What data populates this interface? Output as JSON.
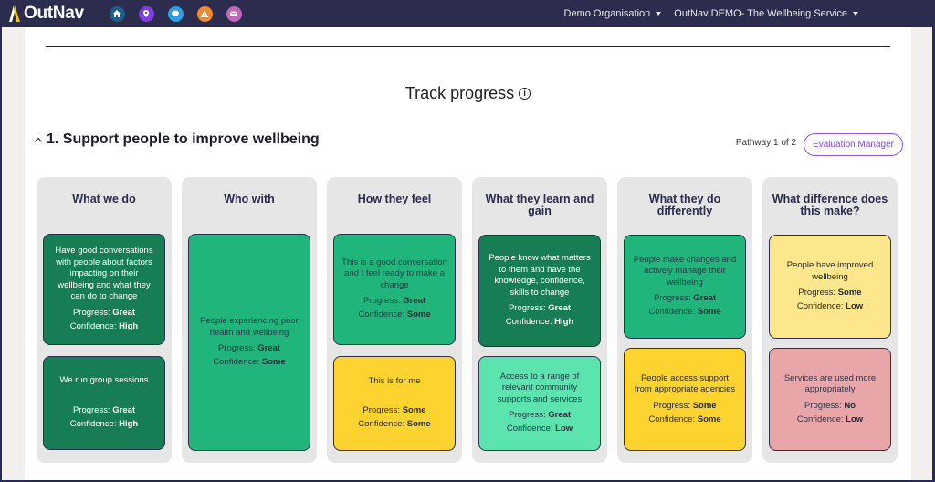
{
  "navbar": {
    "brand": "OutNav",
    "icons": [
      {
        "name": "home-icon",
        "color": "#1f5f87"
      },
      {
        "name": "map-pin-icon",
        "color": "#7d3fe0"
      },
      {
        "name": "chat-bubble-icon",
        "color": "#2d9ee0"
      },
      {
        "name": "warning-icon",
        "color": "#f2892b"
      },
      {
        "name": "envelope-icon",
        "color": "#c068b7"
      }
    ],
    "org_dropdown": "Demo Organisation",
    "service_dropdown": "OutNav DEMO- The Wellbeing Service"
  },
  "page": {
    "title": "Track progress",
    "section_title": "1. Support people to improve wellbeing",
    "pathway_info": "Pathway 1 of 2",
    "evaluation_button": "Evaluation Manager"
  },
  "labels": {
    "progress": "Progress: ",
    "confidence": "Confidence: "
  },
  "columns": [
    {
      "title": "What we do",
      "cards": [
        {
          "text": "Have good conversations with people about factors impacting on their wellbeing and what they can do to change",
          "progress": "Great",
          "confidence": "High",
          "style": "dark"
        },
        {
          "text": "We run group sessions",
          "progress": "Great",
          "confidence": "High",
          "style": "dark"
        }
      ]
    },
    {
      "title": "Who with",
      "cards": [
        {
          "text": "People experiencing poor health and wellbeing",
          "progress": "Great",
          "confidence": "Some",
          "style": "mid"
        }
      ]
    },
    {
      "title": "How they feel",
      "cards": [
        {
          "text": "This is a good conversation and I feel ready to make a change",
          "progress": "Great",
          "confidence": "Some",
          "style": "mid"
        },
        {
          "text": "This is for me",
          "progress": "Some",
          "confidence": "Some",
          "style": "yellow"
        }
      ]
    },
    {
      "title": "What they learn and gain",
      "cards": [
        {
          "text": "People know what matters to them and have the knowledge, confidence, skills to change",
          "progress": "Great",
          "confidence": "High",
          "style": "dark"
        },
        {
          "text": "Access to a range of relevant community supports and services",
          "progress": "Great",
          "confidence": "Low",
          "style": "light"
        }
      ]
    },
    {
      "title": "What they do differently",
      "cards": [
        {
          "text": "People make changes and actively manage their wellbeing",
          "progress": "Great",
          "confidence": "Some",
          "style": "mid"
        },
        {
          "text": "People access support from appropriate agencies",
          "progress": "Some",
          "confidence": "Some",
          "style": "yellow"
        }
      ]
    },
    {
      "title": "What difference does this make?",
      "cards": [
        {
          "text": "People have improved wellbeing",
          "progress": "Some",
          "confidence": "Low",
          "style": "pale"
        },
        {
          "text": "Services are used more appropriately",
          "progress": "No",
          "confidence": "Low",
          "style": "pink"
        }
      ]
    }
  ]
}
